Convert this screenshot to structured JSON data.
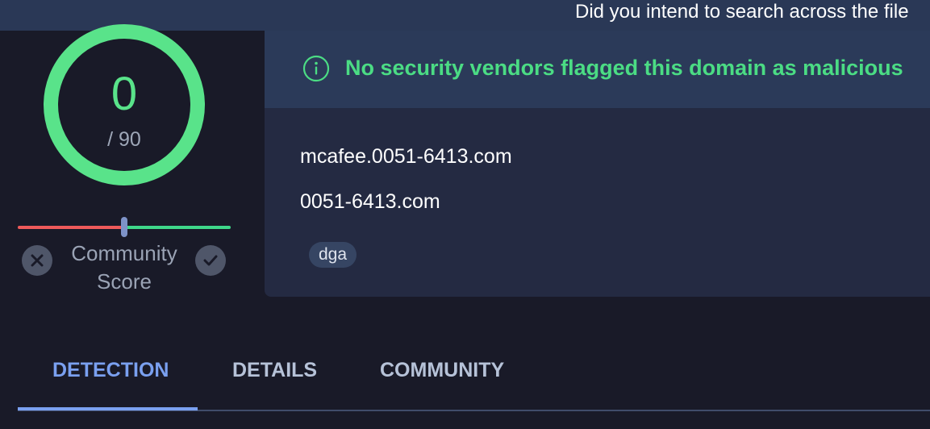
{
  "top_bar": {
    "notice": "Did you intend to search across the file"
  },
  "score": {
    "value": "0",
    "total": "/ 90",
    "ring_color": "#59e38a"
  },
  "community_score": {
    "label_line1": "Community",
    "label_line2": "Score",
    "down_icon": "close-icon",
    "up_icon": "checkmark-icon"
  },
  "verdict": {
    "icon": "info-icon",
    "text": "No security vendors flagged this domain as malicious",
    "color": "#4bdc84"
  },
  "domain": {
    "name": "mcafee.0051-6413.com",
    "parent": "0051-6413.com",
    "tags": [
      "dga"
    ]
  },
  "tabs": [
    {
      "label": "DETECTION",
      "active": true
    },
    {
      "label": "DETAILS",
      "active": false
    },
    {
      "label": "COMMUNITY",
      "active": false
    }
  ],
  "colors": {
    "accent": "#7aa0f0",
    "background": "#191a28",
    "card": "#242a42"
  }
}
